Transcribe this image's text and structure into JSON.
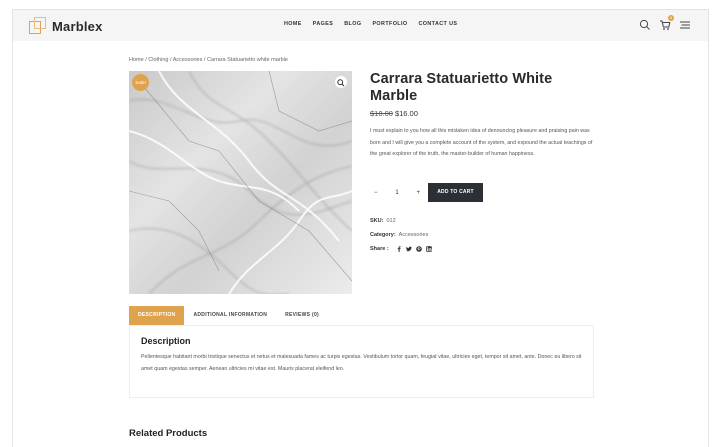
{
  "header": {
    "logo_text": "Marblex",
    "nav": [
      "HOME",
      "PAGES",
      "BLOG",
      "PORTFOLIO",
      "CONTACT US"
    ],
    "cart_count": "0"
  },
  "breadcrumb": "Home / Clothing / Accessories / Carrara Statuarietto white marble",
  "product": {
    "sale_label": "Sale!",
    "title": "Carrara Statuarietto White Marble",
    "old_price": "$18.00",
    "new_price": "$16.00",
    "description": "I must explain to you how all this mistaken idea of denouncing pleasure and praising pain was born and I will give you a complete account of the system, and expound the actual teachings of the great explorer of the truth, the master-builder of human happiness.",
    "qty_minus": "−",
    "qty_value": "1",
    "qty_plus": "+",
    "add_to_cart": "ADD TO CART",
    "sku_label": "SKU:",
    "sku_value": "012",
    "category_label": "Category:",
    "category_value": "Accessories",
    "share_label": "Share :"
  },
  "tabs": [
    "DESCRIPTION",
    "ADDITIONAL INFORMATION",
    "REVIEWS (0)"
  ],
  "tab_panel": {
    "heading": "Description",
    "text": "Pellentesque habitant morbi tristique senectus et netus et malesuada fames ac turpis egestas. Vestibulum tortor quam, feugiat vitae, ultricies eget, tempor sit amet, ante. Donec eu libero sit amet quam egestas semper. Aenean ultricies mi vitae est. Mauris placerat eleifend leo."
  },
  "related_title": "Related Products",
  "colors": {
    "accent": "#e0a34d",
    "button_dark": "#2c2f36",
    "header_bg": "#f5f5f6"
  }
}
